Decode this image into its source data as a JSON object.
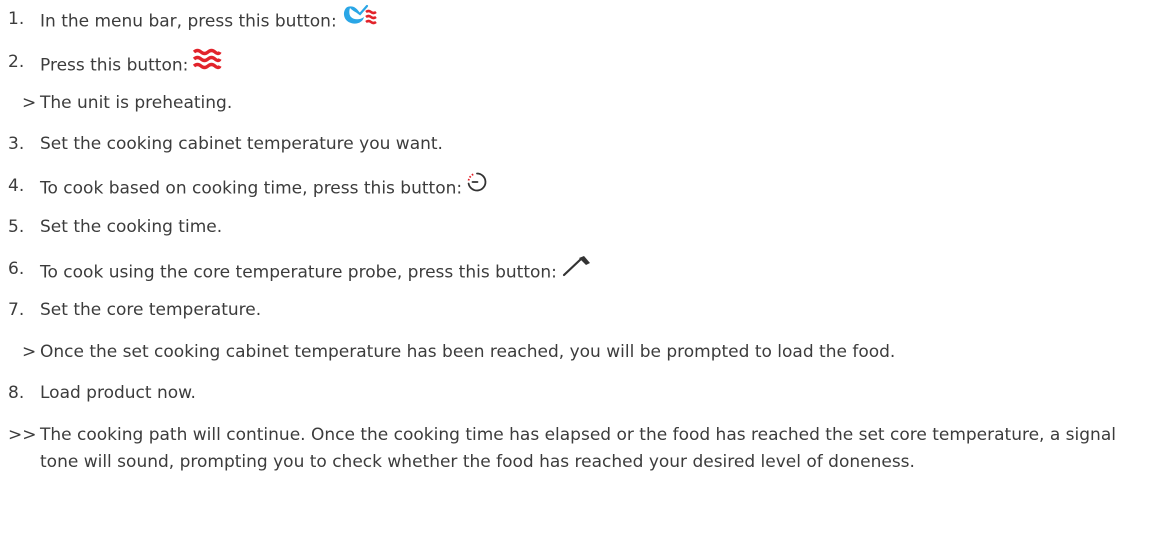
{
  "steps": [
    {
      "marker": "1.",
      "text": "In the menu bar, press this button:",
      "icon": "hot-air-steam-icon"
    },
    {
      "marker": "2.",
      "text": "Press this button:",
      "icon": "preheat-icon"
    },
    {
      "marker": ">",
      "text": "The unit is preheating."
    },
    {
      "marker": "3.",
      "text": "Set the cooking cabinet temperature you want."
    },
    {
      "marker": "4.",
      "text": "To cook based on cooking time, press this button:",
      "icon": "timer-icon"
    },
    {
      "marker": "5.",
      "text": "Set the cooking time."
    },
    {
      "marker": "6.",
      "text": "To cook using the core temperature probe, press this button:",
      "icon": "core-probe-icon"
    },
    {
      "marker": "7.",
      "text": "Set the core temperature."
    },
    {
      "marker": ">",
      "text": "Once the set cooking cabinet temperature has been reached, you will be prompted to load the food."
    },
    {
      "marker": "8.",
      "text": "Load product now."
    },
    {
      "marker": ">>",
      "text": "The cooking path will continue. Once the cooking time has elapsed or the food has reached the set core temperature, a signal tone will sound, prompting you to check whether the food has reached your desired level of doneness."
    }
  ],
  "colors": {
    "text": "#3c3c3c",
    "icon_blue": "#2aa6e6",
    "icon_red": "#e2232b",
    "icon_dark": "#333333"
  }
}
